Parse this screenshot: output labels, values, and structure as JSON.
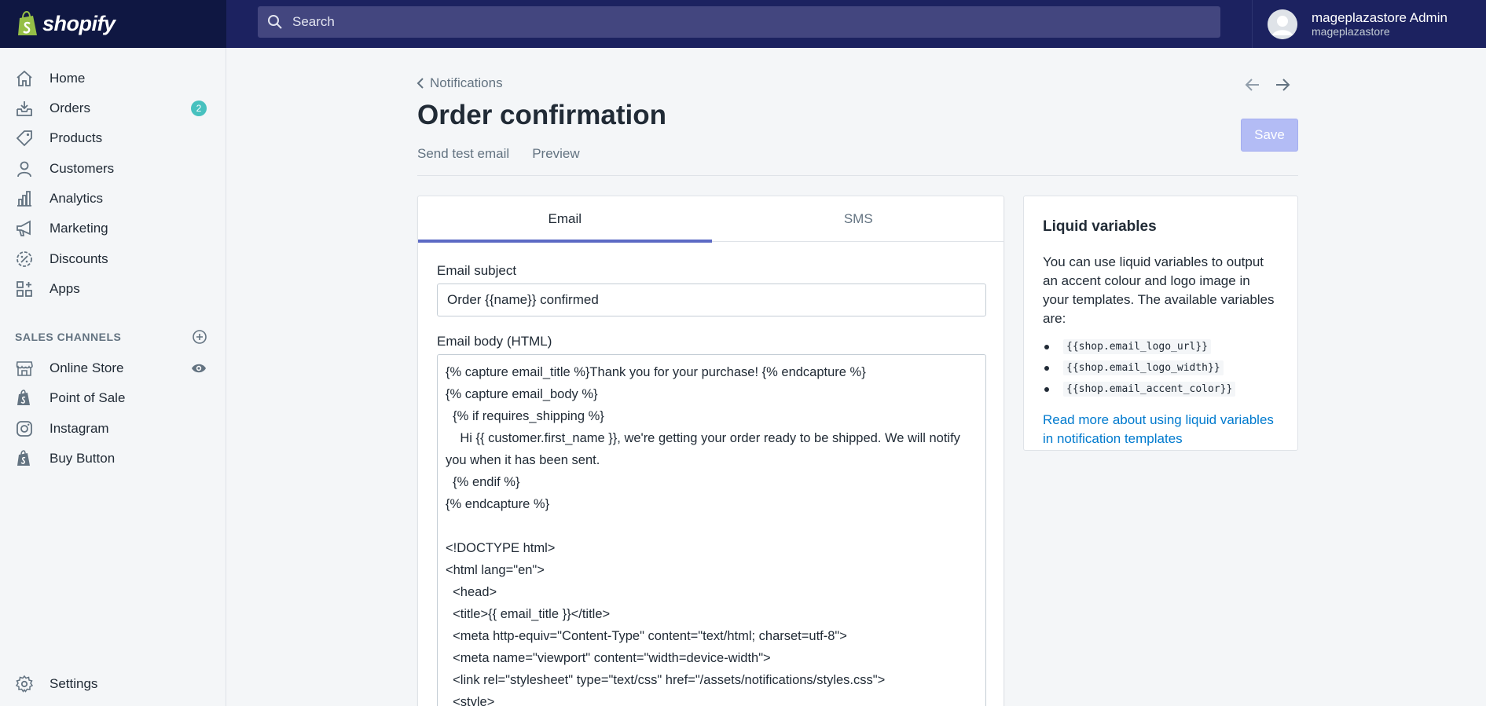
{
  "topbar": {
    "brand": "shopify",
    "search_placeholder": "Search",
    "user_name": "mageplazastore Admin",
    "user_store": "mageplazastore"
  },
  "sidebar": {
    "items": [
      {
        "label": "Home",
        "icon": "home-icon"
      },
      {
        "label": "Orders",
        "icon": "orders-icon",
        "badge": "2"
      },
      {
        "label": "Products",
        "icon": "tag-icon"
      },
      {
        "label": "Customers",
        "icon": "person-icon"
      },
      {
        "label": "Analytics",
        "icon": "bar-chart-icon"
      },
      {
        "label": "Marketing",
        "icon": "megaphone-icon"
      },
      {
        "label": "Discounts",
        "icon": "discount-icon"
      },
      {
        "label": "Apps",
        "icon": "apps-icon"
      }
    ],
    "sales_channels_title": "SALES CHANNELS",
    "channels": [
      {
        "label": "Online Store",
        "icon": "store-icon"
      },
      {
        "label": "Point of Sale",
        "icon": "shopify-bag-icon"
      },
      {
        "label": "Instagram",
        "icon": "instagram-icon"
      },
      {
        "label": "Buy Button",
        "icon": "shopify-bag-icon"
      }
    ],
    "settings_label": "Settings"
  },
  "main": {
    "breadcrumb": "Notifications",
    "title": "Order confirmation",
    "actions": [
      "Send test email",
      "Preview"
    ],
    "save_label": "Save",
    "tabs": [
      "Email",
      "SMS"
    ],
    "subject_label": "Email subject",
    "subject_value": "Order {{name}} confirmed",
    "body_label": "Email body (HTML)",
    "body_lines": [
      "{% capture email_title %}Thank you for your purchase! {% endcapture %}",
      "{% capture email_body %}",
      "  {% if requires_shipping %}",
      "    Hi {{ customer.first_name }}, we're getting your order ready to be shipped. We will notify you when it has been sent.",
      "  {% endif %}",
      "{% endcapture %}",
      "",
      "<!DOCTYPE html>",
      "<html lang=\"en\">",
      "  <head>",
      "  <title>{{ email_title }}</title>",
      "  <meta http-equiv=\"Content-Type\" content=\"text/html; charset=utf-8\">",
      "  <meta name=\"viewport\" content=\"width=device-width\">",
      "  <link rel=\"stylesheet\" type=\"text/css\" href=\"/assets/notifications/styles.css\">",
      "  <style>"
    ]
  },
  "liquid": {
    "title": "Liquid variables",
    "description": "You can use liquid variables to output an accent colour and logo image in your templates. The available variables are:",
    "variables": [
      "{{shop.email_logo_url}}",
      "{{shop.email_logo_width}}",
      "{{shop.email_accent_color}}"
    ],
    "link": "Read more about using liquid variables in notification templates"
  },
  "colors": {
    "topbar": "#1c2260",
    "accent": "#5c6ac4",
    "badge": "#47c1bf",
    "link": "#007ace"
  }
}
